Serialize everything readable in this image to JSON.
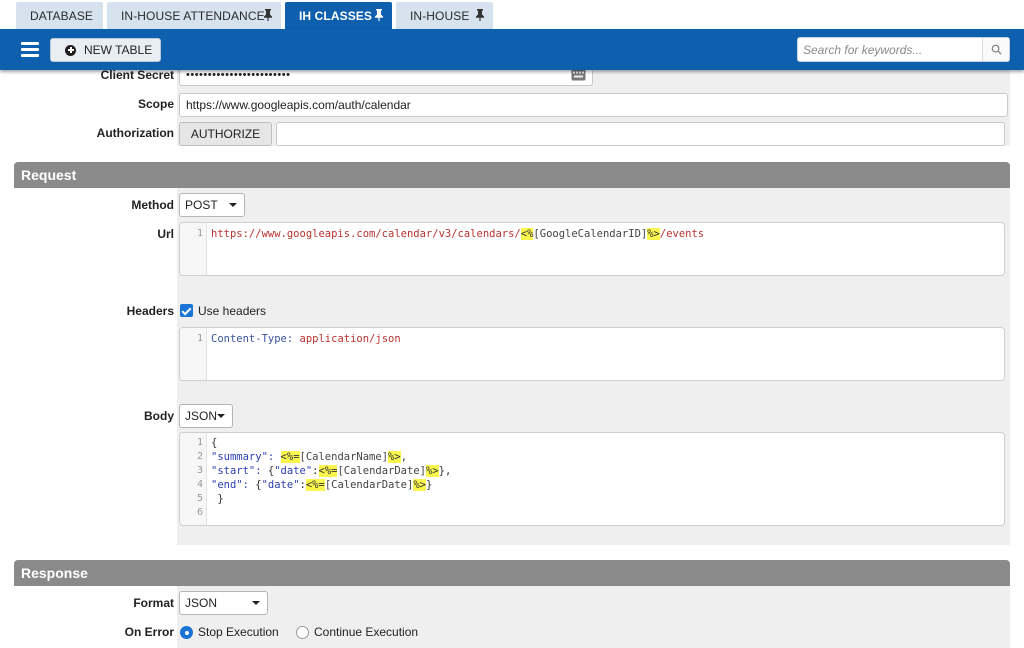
{
  "tabs": [
    {
      "label": "DATABASE",
      "pinned": false,
      "active": false
    },
    {
      "label": "IN-HOUSE ATTENDANCE",
      "pinned": true,
      "active": false
    },
    {
      "label": "IH CLASSES",
      "pinned": true,
      "active": true
    },
    {
      "label": "IN-HOUSE",
      "pinned": true,
      "active": false
    }
  ],
  "header": {
    "new_table_label": "NEW TABLE",
    "search_placeholder": "Search for keywords..."
  },
  "auth": {
    "client_secret_label": "Client Secret",
    "client_secret_value": "••••••••••••••••••••••••",
    "scope_label": "Scope",
    "scope_value": "https://www.googleapis.com/auth/calendar",
    "authorization_label": "Authorization",
    "authorize_button": "AUTHORIZE",
    "authorization_value": ""
  },
  "request": {
    "section_title": "Request",
    "method_label": "Method",
    "method_value": "POST",
    "url_label": "Url",
    "url_line_numbers": [
      "1"
    ],
    "url_parts": [
      "https://www.googleapis.com/calendar/v3/calendars/",
      "<%",
      "[GoogleCalendarID]",
      "%>",
      "/events"
    ],
    "headers_label": "Headers",
    "use_headers_label": "Use headers",
    "use_headers_checked": true,
    "headers_line_numbers": [
      "1"
    ],
    "headers_key": "Content-Type:",
    "headers_value": "application/json",
    "body_label": "Body",
    "body_type": "JSON",
    "body_line_numbers": [
      "1",
      "2",
      "3",
      "4",
      "5",
      "6"
    ],
    "body_lines": {
      "l1": "{",
      "l2_key": "\"summary\":",
      "l2_open": "<%=",
      "l2_var": "[CalendarName]",
      "l2_close": "%>",
      "l2_end": ",",
      "l3_key": "\"start\":",
      "l3_mid": "{",
      "l3_date": "\"date\"",
      "l3_colon": ":",
      "l3_open": "<%=",
      "l3_var": "[CalendarDate]",
      "l3_close": "%>",
      "l3_end": "},",
      "l4_key": "\"end\":",
      "l4_mid": "{",
      "l4_date": "\"date\"",
      "l4_colon": ":",
      "l4_open": "<%=",
      "l4_var": "[CalendarDate]",
      "l4_close": "%>",
      "l4_end": "}",
      "l5": " }",
      "l6": ""
    }
  },
  "response": {
    "section_title": "Response",
    "format_label": "Format",
    "format_value": "JSON",
    "on_error_label": "On Error",
    "stop_execution_label": "Stop Execution",
    "continue_execution_label": "Continue Execution",
    "selected": "stop"
  },
  "colors": {
    "primary": "#0e5fae",
    "tab_inactive": "#d6e3ef",
    "section_header": "#8a8a8a",
    "highlight": "#fbf64d",
    "checkbox": "#1a74d6"
  }
}
